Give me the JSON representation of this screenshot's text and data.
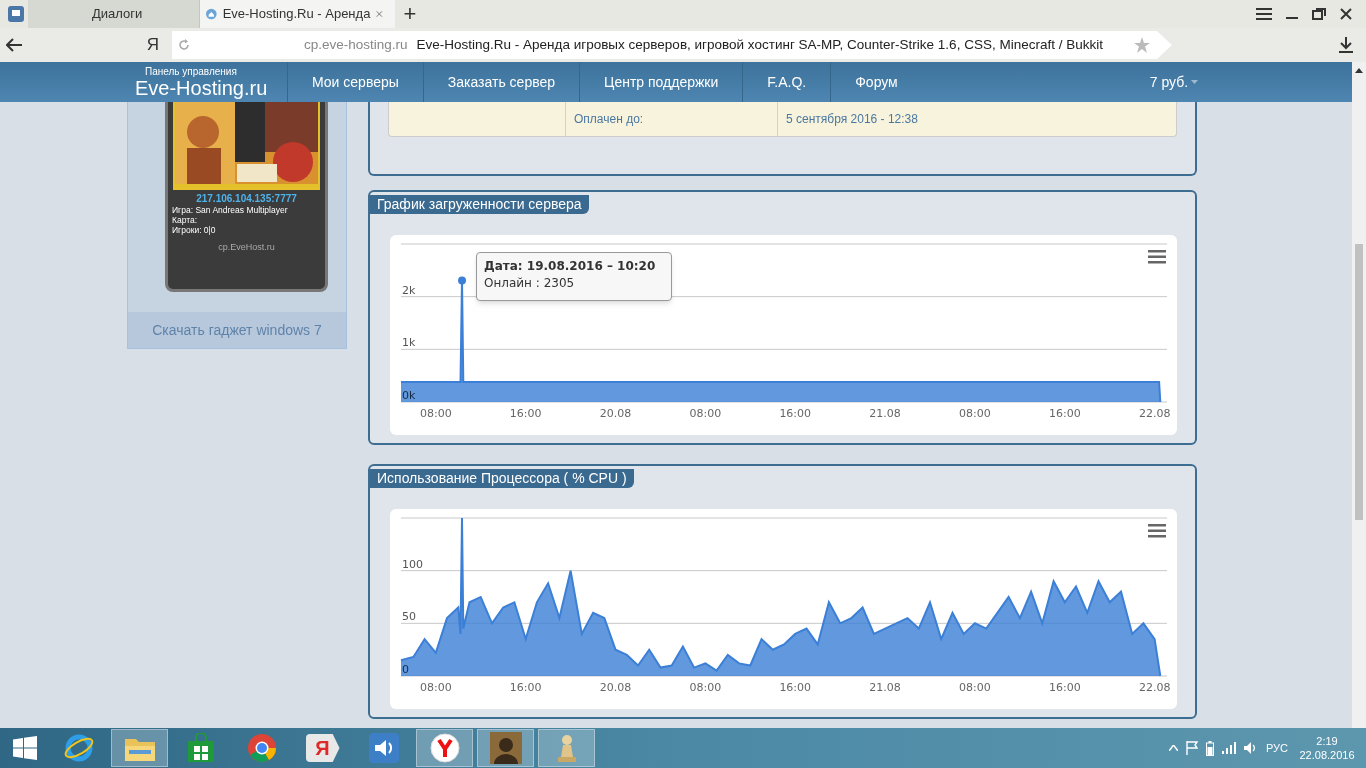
{
  "browser": {
    "tabs": [
      {
        "label": "Диалоги",
        "selected": false
      },
      {
        "label": "Eve-Hosting.Ru - Аренда",
        "selected": true
      }
    ],
    "new_tab": "+",
    "yandex_button": "Я",
    "address": {
      "domain": "cp.eve-hosting.ru",
      "title": "Eve-Hosting.Ru - Аренда игровых серверов, игровой хостинг SA-MP, Counter-Strike 1.6, CSS, Minecraft / Bukkit"
    }
  },
  "nav": {
    "brand_caption": "Панель управления",
    "brand": "Eve-Hosting.ru",
    "items": [
      "Мои серверы",
      "Заказать сервер",
      "Центр поддержки",
      "F.A.Q.",
      "Форум"
    ],
    "balance": "7 руб."
  },
  "gadget": {
    "ip": "217.106.104.135:7777",
    "lines": [
      "Игра: San Andreas Multiplayer",
      "Карта:",
      "Игроки: 0|0"
    ],
    "site": "cp.EveHost.ru",
    "download": "Скачать гаджет windows 7"
  },
  "server_info": {
    "rows": [
      {
        "label": "Оплачен до:",
        "value": "5 сентября 2016 - 12:38"
      }
    ]
  },
  "charts": [
    {
      "title": "График загруженности сервера",
      "tooltip": {
        "title": "Дата: 19.08.2016 – 10:20",
        "text": "Онлайн : 2305"
      },
      "chart_data": {
        "type": "area",
        "x": [
          "2016-08-19T04:54",
          "2016-08-19T10:12",
          "2016-08-19T10:20",
          "2016-08-19T10:27",
          "2016-08-22T00:24",
          "2016-08-22T00:30"
        ],
        "series": [
          {
            "color": "#3b7fd6",
            "values": [
              380,
              380,
              2305,
              380,
              380,
              0
            ]
          }
        ],
        "xlim": [
          "2016-08-19T04:54",
          "2016-08-22T01:06"
        ],
        "ylim": [
          0,
          3000
        ],
        "xticks": [
          {
            "value": "2016-08-19T08:00",
            "label": "08:00"
          },
          {
            "value": "2016-08-19T16:00",
            "label": "16:00"
          },
          {
            "value": "2016-08-20T00:00",
            "label": "20.08"
          },
          {
            "value": "2016-08-20T08:00",
            "label": "08:00"
          },
          {
            "value": "2016-08-20T16:00",
            "label": "16:00"
          },
          {
            "value": "2016-08-21T00:00",
            "label": "21.08"
          },
          {
            "value": "2016-08-21T08:00",
            "label": "08:00"
          },
          {
            "value": "2016-08-21T16:00",
            "label": "16:00"
          },
          {
            "value": "2016-08-22T00:00",
            "label": "22.08"
          }
        ],
        "yticks": [
          {
            "value": 0,
            "label": "0k"
          },
          {
            "value": 1000,
            "label": "1k"
          },
          {
            "value": 2000,
            "label": "2k"
          }
        ]
      }
    },
    {
      "title": "Использование Процессора ( % CPU )",
      "chart_data": {
        "type": "area",
        "x": [
          "2016-08-19T04:54",
          "2016-08-19T06:00",
          "2016-08-19T07:00",
          "2016-08-19T08:00",
          "2016-08-19T09:00",
          "2016-08-19T10:00",
          "2016-08-19T10:12",
          "2016-08-19T10:20",
          "2016-08-19T10:27",
          "2016-08-19T11:00",
          "2016-08-19T12:00",
          "2016-08-19T13:00",
          "2016-08-19T14:00",
          "2016-08-19T15:00",
          "2016-08-19T16:00",
          "2016-08-19T17:00",
          "2016-08-19T18:00",
          "2016-08-19T19:00",
          "2016-08-19T20:00",
          "2016-08-19T21:00",
          "2016-08-19T22:00",
          "2016-08-19T23:00",
          "2016-08-20T00:00",
          "2016-08-20T01:00",
          "2016-08-20T02:00",
          "2016-08-20T03:00",
          "2016-08-20T04:00",
          "2016-08-20T05:00",
          "2016-08-20T06:00",
          "2016-08-20T07:00",
          "2016-08-20T08:00",
          "2016-08-20T09:00",
          "2016-08-20T10:00",
          "2016-08-20T11:00",
          "2016-08-20T12:00",
          "2016-08-20T13:00",
          "2016-08-20T14:00",
          "2016-08-20T15:00",
          "2016-08-20T16:00",
          "2016-08-20T17:00",
          "2016-08-20T18:00",
          "2016-08-20T19:00",
          "2016-08-20T20:00",
          "2016-08-20T21:00",
          "2016-08-20T22:00",
          "2016-08-20T23:00",
          "2016-08-21T00:00",
          "2016-08-21T01:00",
          "2016-08-21T02:00",
          "2016-08-21T03:00",
          "2016-08-21T04:00",
          "2016-08-21T05:00",
          "2016-08-21T06:00",
          "2016-08-21T07:00",
          "2016-08-21T08:00",
          "2016-08-21T09:00",
          "2016-08-21T10:00",
          "2016-08-21T11:00",
          "2016-08-21T12:00",
          "2016-08-21T13:00",
          "2016-08-21T14:00",
          "2016-08-21T15:00",
          "2016-08-21T16:00",
          "2016-08-21T17:00",
          "2016-08-21T18:00",
          "2016-08-21T19:00",
          "2016-08-21T20:00",
          "2016-08-21T21:00",
          "2016-08-21T22:00",
          "2016-08-21T23:00",
          "2016-08-22T00:00",
          "2016-08-22T00:30"
        ],
        "series": [
          {
            "color": "#3b7fd6",
            "values": [
              15,
              18,
              35,
              22,
              55,
              65,
              40,
              150,
              45,
              70,
              75,
              50,
              65,
              70,
              35,
              70,
              88,
              55,
              100,
              40,
              60,
              55,
              25,
              20,
              10,
              25,
              8,
              10,
              28,
              8,
              12,
              5,
              20,
              12,
              10,
              35,
              25,
              30,
              40,
              45,
              30,
              70,
              50,
              55,
              65,
              40,
              45,
              50,
              55,
              45,
              70,
              35,
              60,
              40,
              50,
              45,
              60,
              75,
              55,
              80,
              50,
              90,
              70,
              85,
              60,
              90,
              70,
              80,
              40,
              50,
              35,
              0
            ]
          }
        ],
        "xlim": [
          "2016-08-19T04:54",
          "2016-08-22T01:06"
        ],
        "ylim": [
          0,
          150
        ],
        "xticks": [
          {
            "value": "2016-08-19T08:00",
            "label": "08:00"
          },
          {
            "value": "2016-08-19T16:00",
            "label": "16:00"
          },
          {
            "value": "2016-08-20T00:00",
            "label": "20.08"
          },
          {
            "value": "2016-08-20T08:00",
            "label": "08:00"
          },
          {
            "value": "2016-08-20T16:00",
            "label": "16:00"
          },
          {
            "value": "2016-08-21T00:00",
            "label": "21.08"
          },
          {
            "value": "2016-08-21T08:00",
            "label": "08:00"
          },
          {
            "value": "2016-08-21T16:00",
            "label": "16:00"
          },
          {
            "value": "2016-08-22T00:00",
            "label": "22.08"
          }
        ],
        "yticks": [
          0,
          50,
          100
        ]
      }
    }
  ],
  "taskbar": {
    "apps": [
      {
        "kind": "ie",
        "active": false
      },
      {
        "kind": "explorer",
        "active": true
      },
      {
        "kind": "store",
        "active": false
      },
      {
        "kind": "chrome",
        "active": false
      },
      {
        "kind": "yandex",
        "active": false,
        "label": "Я"
      },
      {
        "kind": "sound",
        "active": false
      },
      {
        "kind": "yandex-browser",
        "active": true
      },
      {
        "kind": "game",
        "active": true
      },
      {
        "kind": "chess",
        "active": true
      }
    ],
    "tray": {
      "language": "РУС",
      "time": "2:19",
      "date": "22.08.2016"
    }
  }
}
